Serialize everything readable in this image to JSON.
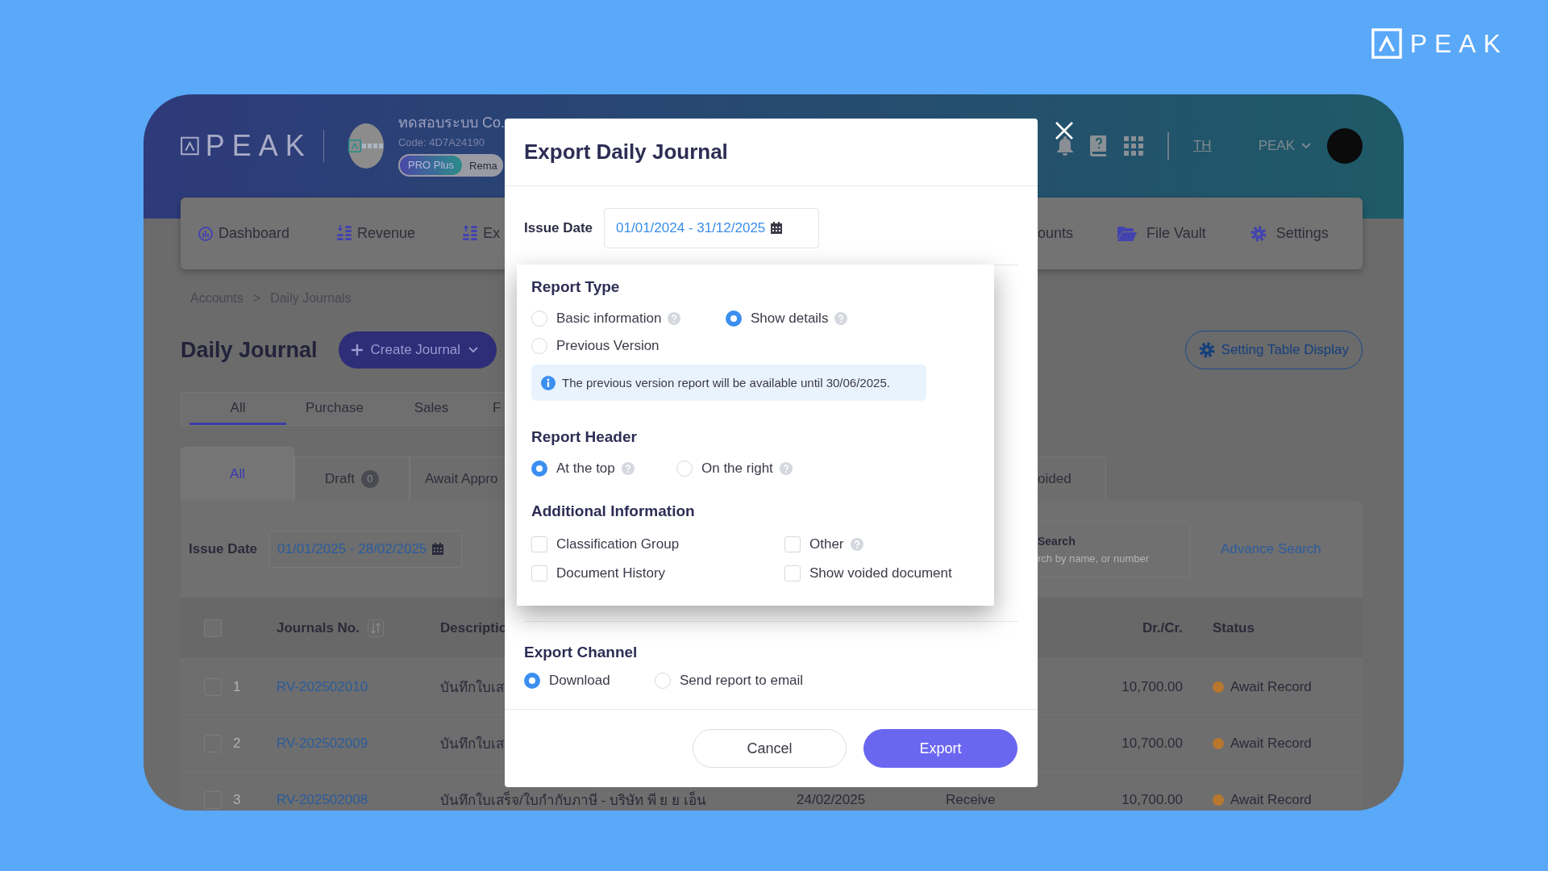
{
  "brand_logo": {
    "text": "PEAK"
  },
  "app": {
    "header": {
      "logo_text": "PEAK",
      "company_name": "ทดสอบระบบ Co.",
      "company_code": "Code: 4D7A24190",
      "plan": "PRO Plus",
      "plan_note": "Rema",
      "language": "TH",
      "user_name": "PEAK"
    },
    "nav_left": [
      {
        "label": "Dashboard",
        "kind": "dashboard"
      },
      {
        "label": "Revenue",
        "kind": "revenue"
      },
      {
        "label": "Ex",
        "kind": "expense"
      }
    ],
    "nav_right": [
      {
        "label": "ounts",
        "kind": "none"
      },
      {
        "label": "File Vault",
        "kind": "folder"
      },
      {
        "label": "Settings",
        "kind": "settings"
      }
    ],
    "breadcrumb": [
      "Accounts",
      ">",
      "Daily Journals"
    ],
    "page_title": "Daily Journal",
    "create_button": "Create Journal",
    "table_settings_button": "Setting Table Display",
    "category_tabs": [
      {
        "label": "All",
        "selected": true
      },
      {
        "label": "Purchase",
        "selected": false
      },
      {
        "label": "Sales",
        "selected": false
      },
      {
        "label": "F",
        "selected": false
      }
    ],
    "status_tabs_left": [
      {
        "label": "All",
        "selected": true
      },
      {
        "label": "Draft",
        "count": "0",
        "selected": false
      },
      {
        "label": "Await Appro",
        "selected": false
      }
    ],
    "status_tabs_right": [
      {
        "label": "oided",
        "selected": false
      }
    ],
    "filter": {
      "issue_date_label": "Issue Date",
      "issue_date": "01/01/2025 - 28/02/2025",
      "search_label": "Search",
      "search_placeholder": "rch by name, or number",
      "advance_search": "Advance Search"
    },
    "table": {
      "header_checked": false,
      "columns": [
        {
          "label": "Journals No.",
          "kind": "journal",
          "sortable": true
        },
        {
          "label": "Descriptio",
          "kind": "description",
          "sortable": false
        },
        {
          "label": "Dr./Cr.",
          "kind": "amount",
          "sortable": false
        },
        {
          "label": "Status",
          "kind": "status",
          "sortable": false
        }
      ],
      "rows": [
        {
          "checked": false,
          "index": "1",
          "journal_no": "RV-202502010",
          "description": "บันทึกใบเส",
          "amount": "10,700.00",
          "status": "Await Record",
          "color": "#b8772e"
        },
        {
          "checked": false,
          "index": "2",
          "journal_no": "RV-202502009",
          "description": "บันทึกใบเส",
          "amount": "10,700.00",
          "status": "Await Record",
          "color": "#b8772e"
        },
        {
          "checked": false,
          "index": "3",
          "journal_no": "RV-202502008",
          "description": "บันทึกใบเสร็จ/ใบกำกับภาษี - บริษัท พี ย ย เอ็น",
          "date": "24/02/2025",
          "type": "Receive",
          "amount": "10,700.00",
          "status": "Await Record",
          "color": "#b8772e"
        }
      ]
    }
  },
  "export_dialog": {
    "title": "Export Daily Journal",
    "issue_date_label": "Issue Date",
    "issue_date": "01/01/2024 - 31/12/2025",
    "report_type": {
      "heading": "Report Type",
      "options": [
        {
          "label": "Basic information",
          "selected": false,
          "help": true
        },
        {
          "label": "Show details",
          "selected": true,
          "help": true
        },
        {
          "label": "Previous Version",
          "selected": false,
          "help": false
        }
      ],
      "notice": "The previous version report will be available until 30/06/2025."
    },
    "report_header": {
      "heading": "Report Header",
      "options": [
        {
          "label": "At the top",
          "selected": true,
          "help": true
        },
        {
          "label": "On the right",
          "selected": false,
          "help": true
        }
      ]
    },
    "additional_information": {
      "heading": "Additional Information",
      "options": [
        {
          "label": "Classification Group",
          "checked": false,
          "help": false
        },
        {
          "label": "Other",
          "checked": false,
          "help": true
        },
        {
          "label": "Document History",
          "checked": false,
          "help": false
        },
        {
          "label": "Show voided document",
          "checked": false,
          "help": false
        }
      ]
    },
    "export_channel": {
      "heading": "Export Channel",
      "options": [
        {
          "label": "Download",
          "selected": true
        },
        {
          "label": "Send report to email",
          "selected": false
        }
      ]
    },
    "buttons": [
      {
        "label": "Cancel",
        "kind": "secondary"
      },
      {
        "label": "Export",
        "kind": "primary"
      }
    ]
  }
}
